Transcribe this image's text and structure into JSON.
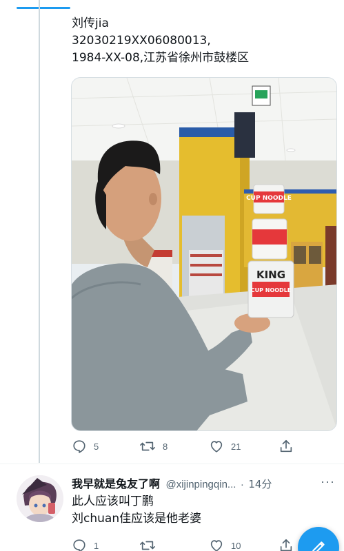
{
  "tweet": {
    "lines": [
      "刘传jia",
      "32030219XX06080013,",
      "1984-XX-08,江苏省徐州市鼓楼区"
    ],
    "actions": {
      "reply_count": "5",
      "retweet_count": "8",
      "like_count": "21"
    },
    "media_overlay_text": {
      "cup_top": "CUP NOODLE",
      "cup_bottom_brand": "KING",
      "cup_bottom": "CUP NOODLE"
    }
  },
  "reply": {
    "name": "我早就是兔友了啊",
    "handle": "@xijinpingqin...",
    "dot": "·",
    "time": "14分",
    "lines": [
      "此人应该叫丁鹏",
      "刘chuan佳应该是他老婆"
    ],
    "actions": {
      "reply_count": "1",
      "like_count": "10"
    }
  },
  "colors": {
    "accent": "#1d9bf0",
    "text_primary": "#0f1419",
    "text_secondary": "#536471",
    "thread_line": "#cfd9de"
  },
  "icons": [
    "reply-icon",
    "retweet-icon",
    "like-icon",
    "share-icon",
    "more-icon",
    "compose-icon"
  ]
}
